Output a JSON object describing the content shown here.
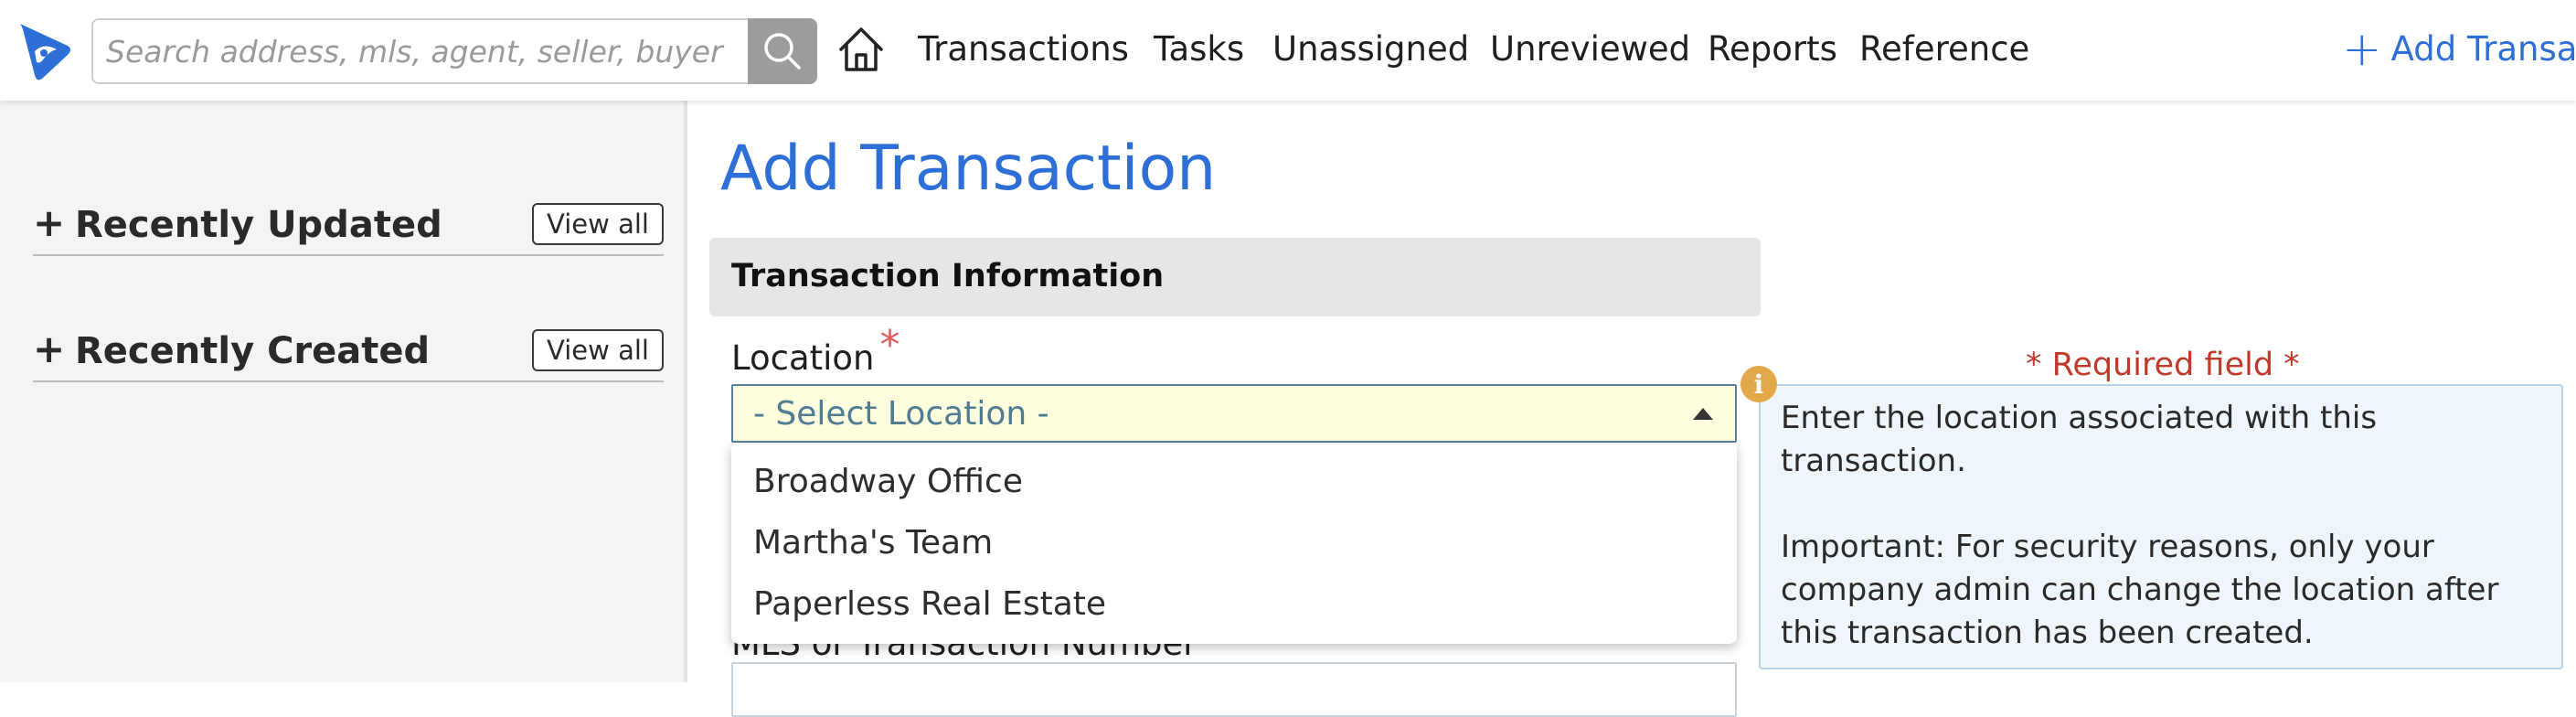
{
  "navbar": {
    "search_placeholder": "Search address, mls, agent, seller, buyer",
    "items": [
      "Transactions",
      "Tasks",
      "Unassigned",
      "Unreviewed",
      "Reports",
      "Reference"
    ],
    "add_transaction": "Add Transa"
  },
  "sidebar": {
    "sections": [
      {
        "toggle": "+",
        "title": "Recently Updated",
        "view_all": "View all"
      },
      {
        "toggle": "+",
        "title": "Recently Created",
        "view_all": "View all"
      }
    ]
  },
  "main": {
    "page_title": "Add Transaction",
    "section_header": "Transaction Information",
    "location_label": "Location",
    "required_star": "*",
    "select_value": "- Select Location -",
    "options": [
      "Broadway Office",
      "Martha's Team",
      "Paperless Real Estate"
    ],
    "next_field_label": "MLS or Transaction Number"
  },
  "help": {
    "required_note": "* Required field *",
    "info_icon": "i",
    "paragraph1": "Enter the location associated with this transaction.",
    "paragraph2": "Important: For security reasons, only your company admin can change the location after this transaction has been created."
  },
  "colors": {
    "accent": "#2d6fd6",
    "required": "#c0392b",
    "select_bg": "#fefdde",
    "help_bg": "#eef6fb"
  }
}
